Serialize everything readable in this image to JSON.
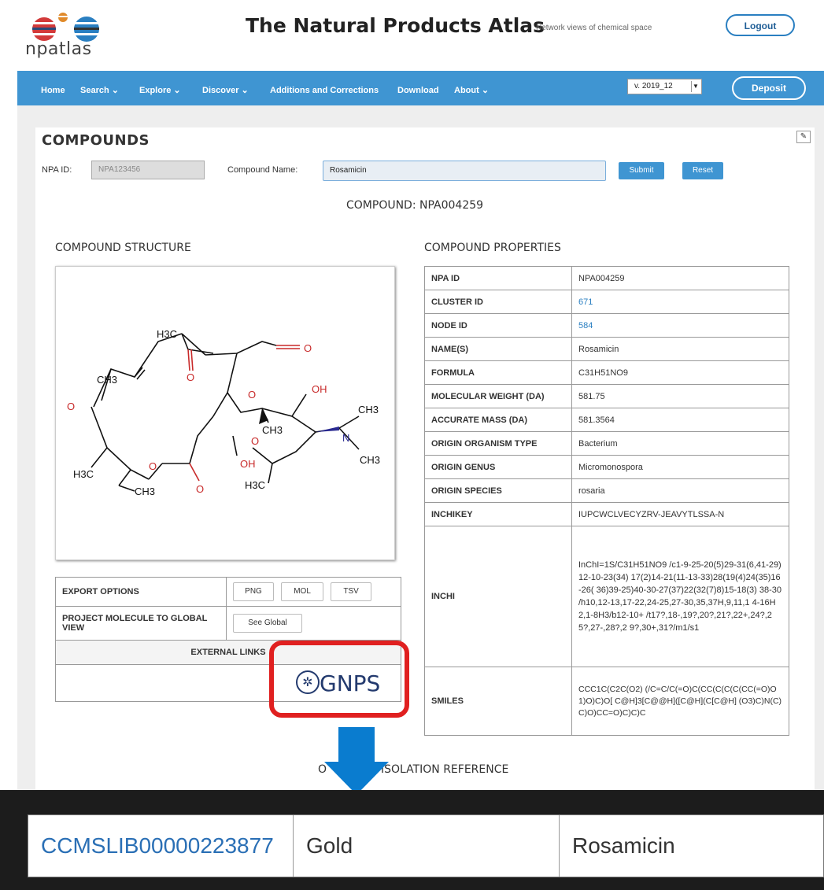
{
  "header": {
    "logo_text": "npatlas",
    "title": "The Natural Products Atlas",
    "tagline": "Network views of chemical space",
    "logout_label": "Logout"
  },
  "nav": {
    "items": [
      "Home",
      "Search ⌄",
      "Explore ⌄",
      "Discover ⌄",
      "Additions and Corrections",
      "Download",
      "About ⌄"
    ],
    "version": "v. 2019_12",
    "deposit_label": "Deposit"
  },
  "compounds": {
    "heading": "COMPOUNDS",
    "npa_id_label": "NPA ID:",
    "npa_id_placeholder": "NPA123456",
    "name_label": "Compound Name:",
    "name_value": "Rosamicin",
    "submit_label": "Submit",
    "reset_label": "Reset",
    "compound_title": "COMPOUND: NPA004259"
  },
  "structure": {
    "title": "COMPOUND STRUCTURE",
    "labels": {
      "h3c_top": "H3C",
      "o_ald": "O",
      "ch3_left": "CH3",
      "o_epox": "O",
      "o_keto": "O",
      "o_ring": "O",
      "oh_top": "OH",
      "ch3_nme1": "CH3",
      "ch3_mid": "CH3",
      "n": "N",
      "ch3_nme2": "CH3",
      "o_sugar": "O",
      "oh_bottom": "OH",
      "h3c_left": "H3C",
      "o_lact": "O",
      "o_carbonyl": "O",
      "ch3_bottom": "CH3",
      "h3c_bottom": "H3C"
    }
  },
  "export": {
    "options_label": "EXPORT OPTIONS",
    "png": "PNG",
    "mol": "MOL",
    "tsv": "TSV",
    "project_label": "PROJECT MOLECULE TO GLOBAL VIEW",
    "see_global": "See Global",
    "external_links": "EXTERNAL LINKS",
    "gnps": "GNPS"
  },
  "properties": {
    "title": "COMPOUND PROPERTIES",
    "rows": [
      {
        "key": "NPA ID",
        "value": "NPA004259"
      },
      {
        "key": "CLUSTER ID",
        "value": "671"
      },
      {
        "key": "NODE ID",
        "value": "584"
      },
      {
        "key": "NAME(S)",
        "value": "Rosamicin"
      },
      {
        "key": "FORMULA",
        "value": "C31H51NO9"
      },
      {
        "key": "MOLECULAR WEIGHT (DA)",
        "value": "581.75"
      },
      {
        "key": "ACCURATE MASS (DA)",
        "value": "581.3564"
      },
      {
        "key": "ORIGIN ORGANISM TYPE",
        "value": "Bacterium"
      },
      {
        "key": "ORIGIN GENUS",
        "value": "Micromonospora"
      },
      {
        "key": "ORIGIN SPECIES",
        "value": "rosaria"
      },
      {
        "key": "INCHIKEY",
        "value": "IUPCWCLVECYZRV-JEAVYTLSSA-N"
      },
      {
        "key": "INCHI",
        "value": "InChI=1S/C31H51NO9 /c1-9-25-20(5)29-31(6,41-29)12-10-23(34) 17(2)14-21(11-13-33)28(19(4)24(35)16-26( 36)39-25)40-30-27(37)22(32(7)8)15-18(3) 38-30 /h10,12-13,17-22,24-25,27-30,35,37H,9,11,1 4-16H2,1-8H3/b12-10+ /t17?,18-,19?,20?,21?,22+,24?,25?,27-,28?,2 9?,30+,31?/m1/s1"
      },
      {
        "key": "SMILES",
        "value": "CCC1C(C2C(O2) (/C=C/C(=O)C(CC(C(C(C(CC(=O)O1)O)C)O[ C@H]3[C@@H]([C@H](C[C@H] (O3)C)N(C)C)O)CC=O)C)C)C"
      }
    ]
  },
  "isolation": {
    "heading_left": "O",
    "heading_right": "ISOLATION REFERENCE"
  },
  "gnps_result": {
    "library_id": "CCMSLIB00000223877",
    "quality": "Gold",
    "compound": "Rosamicin"
  },
  "colors": {
    "nav_blue": "#3f95d2",
    "highlight_red": "#e02020",
    "arrow_blue": "#0a7ccf"
  }
}
